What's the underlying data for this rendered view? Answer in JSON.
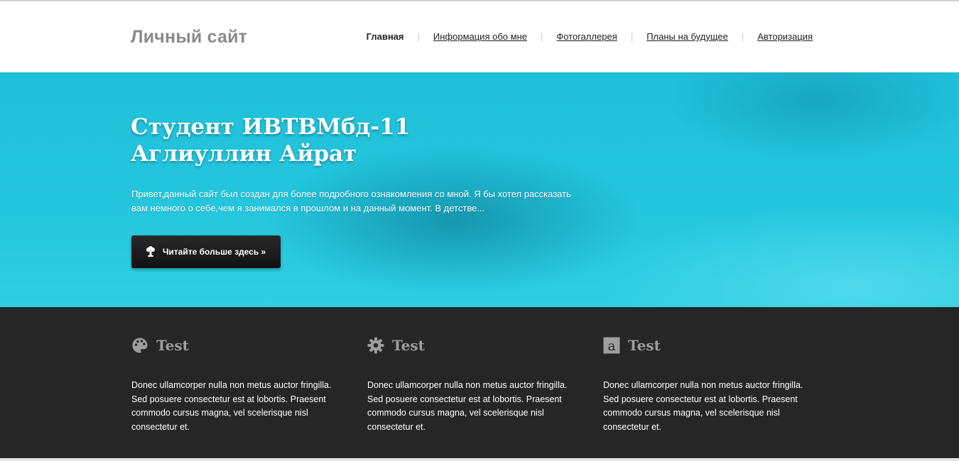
{
  "header": {
    "logo": "Личный сайт",
    "nav": [
      {
        "label": "Главная",
        "active": true
      },
      {
        "label": "Информация обо мне",
        "active": false
      },
      {
        "label": "Фотогаллерея",
        "active": false
      },
      {
        "label": "Планы на будущее",
        "active": false
      },
      {
        "label": "Авторизация",
        "active": false
      }
    ],
    "separator": "|"
  },
  "hero": {
    "title_line1": "Студент ИВТВМбд-11",
    "title_line2": "Аглиуллин Айрат",
    "text": "Привет,данный сайт был создан для более подробного ознакомления со мной. Я бы хотел рассказать вам немного о себе,чем я занимался в прошлом и на данный момент. В детстве...",
    "button_label": "Читайте больше здесь »",
    "button_icon": "mushroom-cloud-icon"
  },
  "features": [
    {
      "icon": "palette-icon",
      "title": "Test",
      "text": "Donec ullamcorper nulla non metus auctor fringilla. Sed posuere consectetur est at lobortis. Praesent commodo cursus magna, vel scelerisque nisl consectetur et."
    },
    {
      "icon": "gear-icon",
      "title": "Test",
      "text": "Donec ullamcorper nulla non metus auctor fringilla. Sed posuere consectetur est at lobortis. Praesent commodo cursus magna, vel scelerisque nisl consectetur et."
    },
    {
      "icon": "letter-a-icon",
      "title": "Test",
      "text": "Donec ullamcorper nulla non metus auctor fringilla. Sed posuere consectetur est at lobortis. Praesent commodo cursus magna, vel scelerisque nisl consectetur et."
    }
  ],
  "colors": {
    "hero_bg": "#24c6dd",
    "features_bg": "#262626",
    "logo": "#8a8a8a",
    "feature_title": "#9e9e9e"
  }
}
